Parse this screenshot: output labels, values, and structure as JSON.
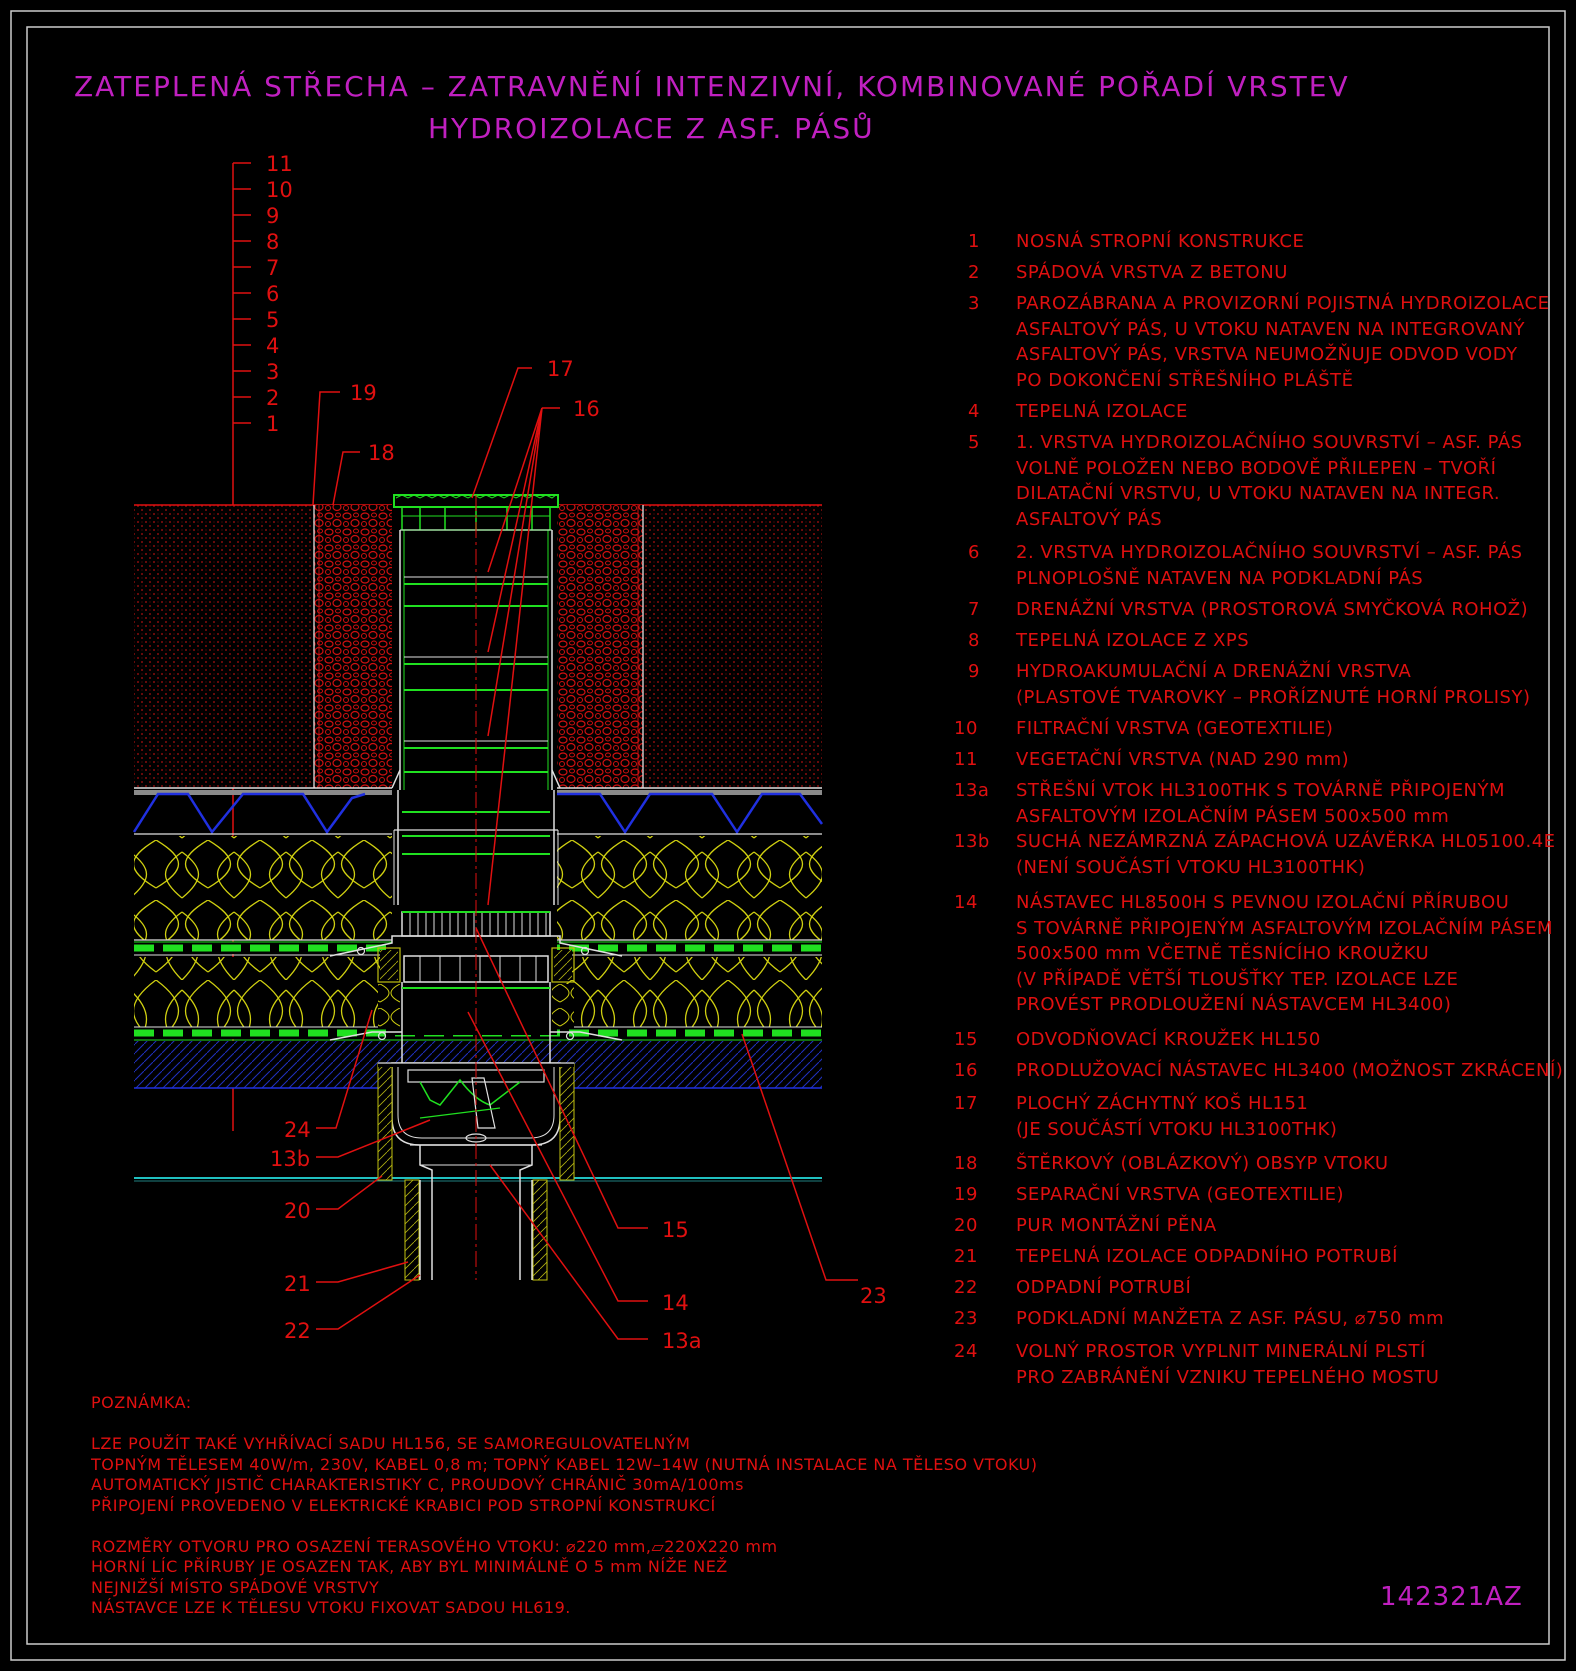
{
  "title": {
    "line1": "ZATEPLENÁ STŘECHA – ZATRAVNĚNÍ INTENZIVNÍ, KOMBINOVANÉ POŘADÍ VRSTEV",
    "line2": "HYDROIZOLACE Z ASF. PÁSŮ"
  },
  "colors": {
    "background": "#000000",
    "red": "#e01010",
    "magenta": "#c020c0",
    "green": "#20e020",
    "yellow": "#e0e020",
    "blue": "#2030e0",
    "cyan": "#20c0c0"
  },
  "layer_scale": [
    "11",
    "10",
    "9",
    "8",
    "7",
    "6",
    "5",
    "4",
    "3",
    "2",
    "1"
  ],
  "callouts": {
    "c17": "17",
    "c16": "16",
    "c19": "19",
    "c18": "18",
    "c24": "24",
    "c13b": "13b",
    "c20": "20",
    "c21": "21",
    "c22": "22",
    "c15": "15",
    "c14": "14",
    "c13a": "13a",
    "c23": "23"
  },
  "legend": [
    {
      "num": "1",
      "text": "NOSNÁ STROPNÍ KONSTRUKCE"
    },
    {
      "num": "2",
      "text": "SPÁDOVÁ VRSTVA Z BETONU"
    },
    {
      "num": "3",
      "text": "PAROZÁBRANA A PROVIZORNÍ POJISTNÁ HYDROIZOLACE\nASFALTOVÝ PÁS, U VTOKU NATAVEN NA INTEGROVANÝ\nASFALTOVÝ PÁS, VRSTVA NEUMOŽŇUJE ODVOD VODY\nPO DOKONČENÍ STŘEŠNÍHO PLÁŠTĚ"
    },
    {
      "num": "4",
      "text": "TEPELNÁ IZOLACE"
    },
    {
      "num": "5",
      "text": "1. VRSTVA HYDROIZOLAČNÍHO SOUVRSTVÍ – ASF. PÁS\nVOLNĚ POLOŽEN NEBO BODOVĚ PŘILEPEN – TVOŘÍ\nDILATAČNÍ VRSTVU, U VTOKU NATAVEN NA INTEGR.\nASFALTOVÝ PÁS"
    },
    {
      "num": "6",
      "text": "2. VRSTVA HYDROIZOLAČNÍHO SOUVRSTVÍ – ASF. PÁS\nPLNOPLOŠNĚ NATAVEN NA PODKLADNÍ PÁS"
    },
    {
      "num": "7",
      "text": "DRENÁŽNÍ VRSTVA (PROSTOROVÁ SMYČKOVÁ ROHOŽ)"
    },
    {
      "num": "8",
      "text": "TEPELNÁ IZOLACE Z XPS"
    },
    {
      "num": "9",
      "text": "HYDROAKUMULAČNÍ A DRENÁŽNÍ VRSTVA\n(PLASTOVÉ TVAROVKY – PROŘÍZNUTÉ HORNÍ PROLISY)"
    },
    {
      "num": "10",
      "text": "FILTRAČNÍ VRSTVA (GEOTEXTILIE)"
    },
    {
      "num": "11",
      "text": "VEGETAČNÍ VRSTVA (NAD 290 mm)"
    },
    {
      "num": "13a",
      "text": "STŘEŠNÍ VTOK HL3100THK S TOVÁRNĚ PŘIPOJENÝM\nASFALTOVÝM IZOLAČNÍM PÁSEM 500x500 mm"
    },
    {
      "num": "13b",
      "text": "SUCHÁ NEZÁMRZNÁ ZÁPACHOVÁ UZÁVĚRKA HL05100.4E\n(NENÍ SOUČÁSTÍ VTOKU HL3100THK)"
    },
    {
      "num": "14",
      "text": "NÁSTAVEC HL8500H S PEVNOU IZOLAČNÍ PŘÍRUBOU\nS TOVÁRNĚ PŘIPOJENÝM ASFALTOVÝM IZOLAČNÍM PÁSEM\n500x500 mm VČETNĚ TĚSNÍCÍHO KROUŽKU\n(V PŘÍPADĚ VĚTŠÍ TLOUŠŤKY TEP. IZOLACE LZE\nPROVÉST PRODLOUŽENÍ NÁSTAVCEM HL3400)"
    },
    {
      "num": "15",
      "text": "ODVODŇOVACÍ KROUŽEK HL150"
    },
    {
      "num": "16",
      "text": "PRODLUŽOVACÍ NÁSTAVEC HL3400 (MOŽNOST ZKRÁCENÍ)"
    },
    {
      "num": "17",
      "text": "PLOCHÝ ZÁCHYTNÝ KOŠ HL151\n(JE SOUČÁSTÍ VTOKU HL3100THK)"
    },
    {
      "num": "18",
      "text": "ŠTĚRKOVÝ (OBLÁZKOVÝ) OBSYP VTOKU"
    },
    {
      "num": "19",
      "text": "SEPARAČNÍ VRSTVA (GEOTEXTILIE)"
    },
    {
      "num": "20",
      "text": "PUR MONTÁŽNÍ PĚNA"
    },
    {
      "num": "21",
      "text": "TEPELNÁ IZOLACE ODPADNÍHO POTRUBÍ"
    },
    {
      "num": "22",
      "text": "ODPADNÍ POTRUBÍ"
    },
    {
      "num": "23",
      "text": "PODKLADNÍ MANŽETA Z ASF. PÁSU, ⌀750 mm"
    },
    {
      "num": "24",
      "text": "VOLNÝ PROSTOR VYPLNIT MINERÁLNÍ PLSTÍ\nPRO ZABRÁNĚNÍ VZNIKU TEPELNÉHO MOSTU"
    }
  ],
  "notes": "POZNÁMKA:\n\nLZE POUŽÍT TAKÉ VYHŘÍVACÍ SADU HL156, SE SAMOREGULOVATELNÝM\nTOPNÝM TĚLESEM 40W/m, 230V, KABEL 0,8 m; TOPNÝ KABEL 12W–14W (NUTNÁ INSTALACE NA TĚLESO VTOKU)\nAUTOMATICKÝ JISTIČ CHARAKTERISTIKY C, PROUDOVÝ CHRÁNIČ 30mA/100ms\nPŘIPOJENÍ PROVEDENO V ELEKTRICKÉ KRABICI POD STROPNÍ KONSTRUKCÍ\n\nROZMĚRY OTVORU PRO OSAZENÍ TERASOVÉHO VTOKU: ⌀220 mm,▱220X220 mm\nHORNÍ LÍC PŘÍRUBY JE OSAZEN TAK, ABY BYL MINIMÁLNĚ O 5 mm NÍŽE NEŽ\nNEJNIŽŠÍ MÍSTO SPÁDOVÉ VRSTVY\nNÁSTAVCE LZE K TĚLESU VTOKU FIXOVAT SADOU HL619.",
  "drawing_code": "142321AZ"
}
